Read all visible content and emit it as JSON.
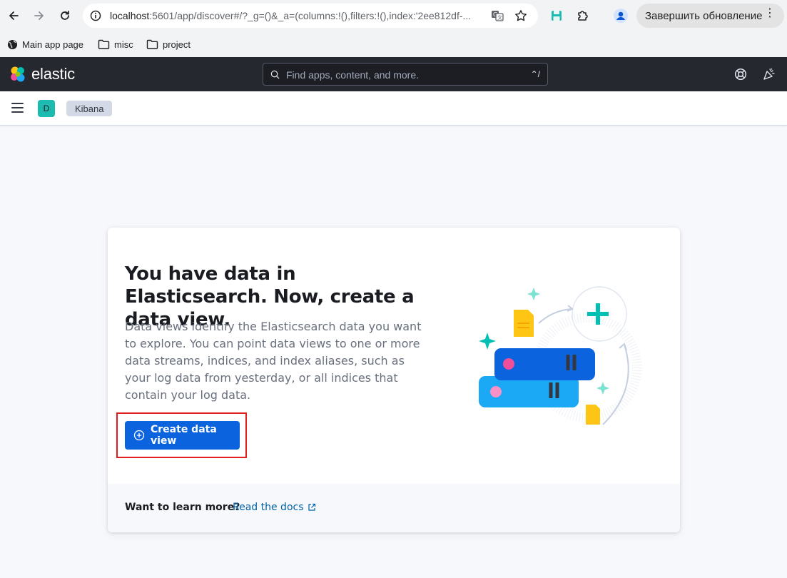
{
  "browser": {
    "url_host": "localhost",
    "url_rest": ":5601/app/discover#/?_g=()&_a=(columns:!(),filters:!(),index:'2ee812df-...",
    "update_button_label": "Завершить обновление",
    "bookmarks": [
      {
        "label": "Main app page",
        "icon": "globe-icon"
      },
      {
        "label": "misc",
        "icon": "folder-icon"
      },
      {
        "label": "project",
        "icon": "folder-icon"
      }
    ]
  },
  "kibana": {
    "logo_text": "elastic",
    "search_placeholder": "Find apps, content, and more.",
    "search_shortcut": "⌃/",
    "space_initial": "D",
    "breadcrumb": "Kibana"
  },
  "prompt": {
    "title": "You have data in Elasticsearch. Now, create a data view.",
    "description": "Data views identify the Elasticsearch data you want to explore. You can point data views to one or more data streams, indices, and index aliases, such as your log data from yesterday, or all indices that contain your log data.",
    "create_button_label": "Create data view",
    "footer_question": "Want to learn more?",
    "docs_link": "Read the docs"
  },
  "colors": {
    "header_bg": "#25282f",
    "primary_button": "#0b64dd",
    "link": "#0061a6",
    "highlight_box": "#e11d1d"
  }
}
